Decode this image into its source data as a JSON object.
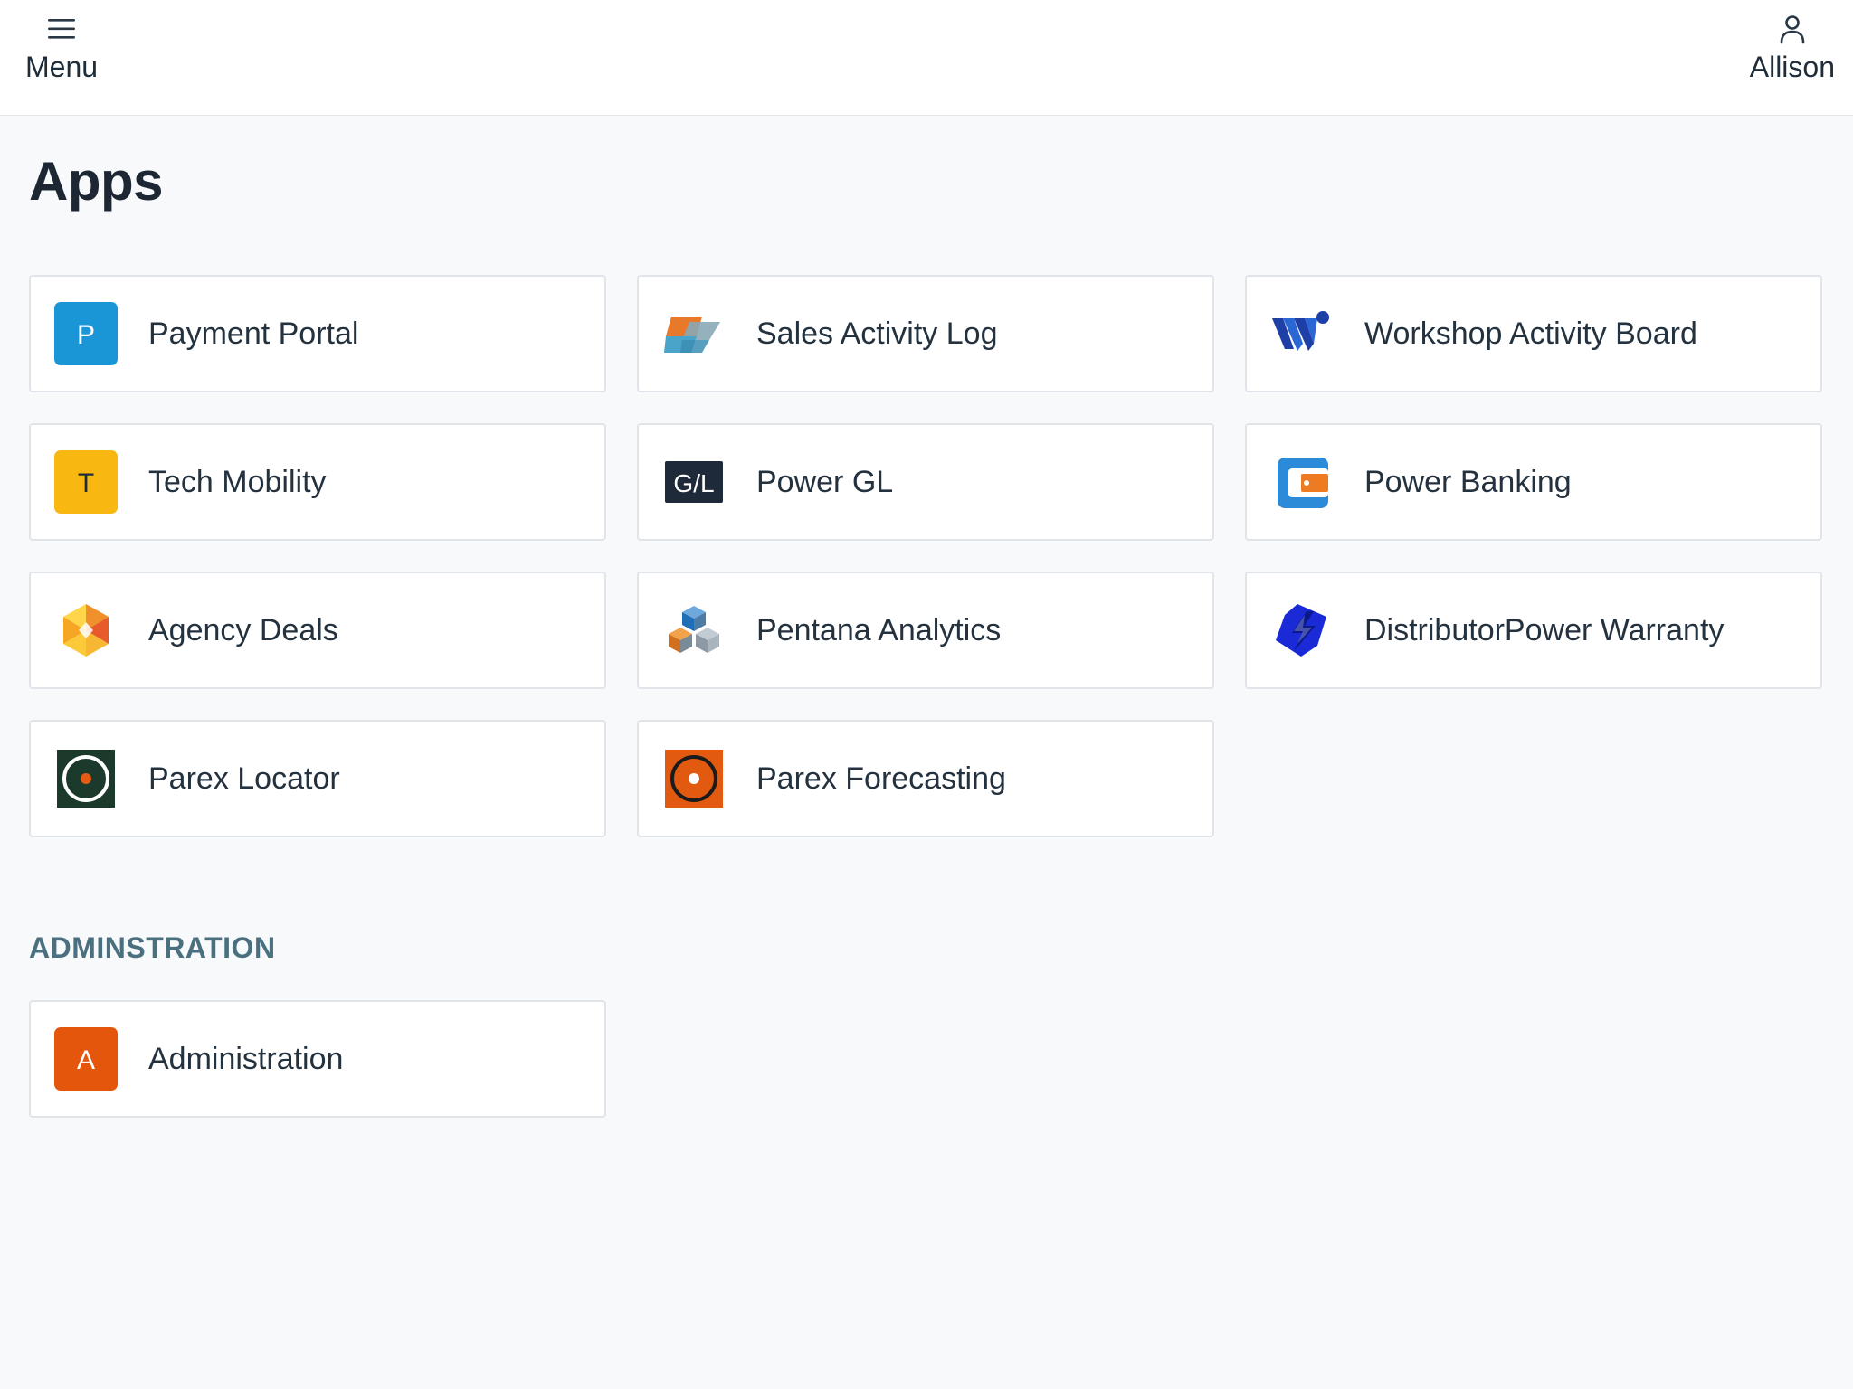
{
  "header": {
    "menu_label": "Menu",
    "menu_icon": "hamburger-icon",
    "user_label": "Allison",
    "user_icon": "user-icon"
  },
  "page": {
    "title": "Apps"
  },
  "apps": [
    {
      "label": "Payment Portal",
      "icon": "letter-p-icon",
      "icon_letter": "P",
      "color": "#1a96d6"
    },
    {
      "label": "Sales Activity Log",
      "icon": "sales-activity-log-icon"
    },
    {
      "label": "Workshop Activity Board",
      "icon": "workshop-w-icon",
      "color": "#1d3fa6"
    },
    {
      "label": "Tech Mobility",
      "icon": "letter-t-icon",
      "icon_letter": "T",
      "color": "#f8b811"
    },
    {
      "label": "Power GL",
      "icon": "gl-icon",
      "icon_text": "G/L",
      "color": "#1e2a3a"
    },
    {
      "label": "Power Banking",
      "icon": "wallet-icon",
      "color": "#2b8bd8"
    },
    {
      "label": "Agency Deals",
      "icon": "hexagon-icon"
    },
    {
      "label": "Pentana Analytics",
      "icon": "cubes-icon"
    },
    {
      "label": "DistributorPower Warranty",
      "icon": "lightning-icon",
      "color": "#1a2ad6"
    },
    {
      "label": "Parex Locator",
      "icon": "target-dark-icon",
      "color": "#1b3a2c"
    },
    {
      "label": "Parex Forecasting",
      "icon": "target-orange-icon",
      "color": "#e15a10"
    }
  ],
  "administration": {
    "section_label": "ADMINSTRATION",
    "items": [
      {
        "label": "Administration",
        "icon": "letter-a-icon",
        "icon_letter": "A",
        "color": "#e5560d"
      }
    ]
  }
}
